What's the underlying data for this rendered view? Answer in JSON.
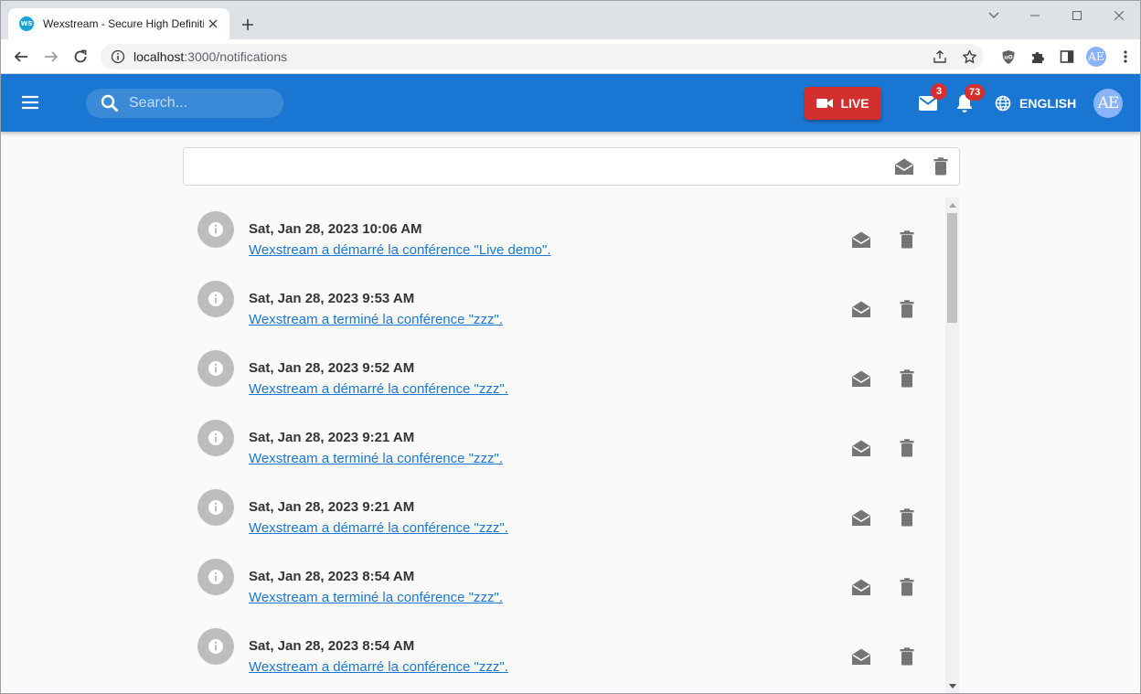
{
  "browser": {
    "tab_title": "Wexstream - Secure High Definition",
    "favicon_text": "WS",
    "url_host": "localhost",
    "url_rest": ":3000/notifications",
    "profile_initials": "AE"
  },
  "appbar": {
    "search_placeholder": "Search...",
    "live_label": "LIVE",
    "messages_count": "3",
    "notifications_count": "73",
    "language_label": "ENGLISH",
    "avatar_initials": "AE",
    "color": "#1976d2",
    "live_color": "#d32f2f"
  },
  "notifications": [
    {
      "date": "Sat, Jan 28, 2023 10:06 AM",
      "message": "Wexstream a démarré la conférence \"Live demo\"."
    },
    {
      "date": "Sat, Jan 28, 2023 9:53 AM",
      "message": "Wexstream a terminé la conférence \"zzz\"."
    },
    {
      "date": "Sat, Jan 28, 2023 9:52 AM",
      "message": "Wexstream a démarré la conférence \"zzz\"."
    },
    {
      "date": "Sat, Jan 28, 2023 9:21 AM",
      "message": "Wexstream a terminé la conférence \"zzz\"."
    },
    {
      "date": "Sat, Jan 28, 2023 9:21 AM",
      "message": "Wexstream a démarré la conférence \"zzz\"."
    },
    {
      "date": "Sat, Jan 28, 2023 8:54 AM",
      "message": "Wexstream a terminé la conférence \"zzz\"."
    },
    {
      "date": "Sat, Jan 28, 2023 8:54 AM",
      "message": "Wexstream a démarré la conférence \"zzz\"."
    }
  ],
  "icons": {
    "info": "info-icon",
    "read": "mark-read-icon",
    "delete": "delete-icon"
  }
}
